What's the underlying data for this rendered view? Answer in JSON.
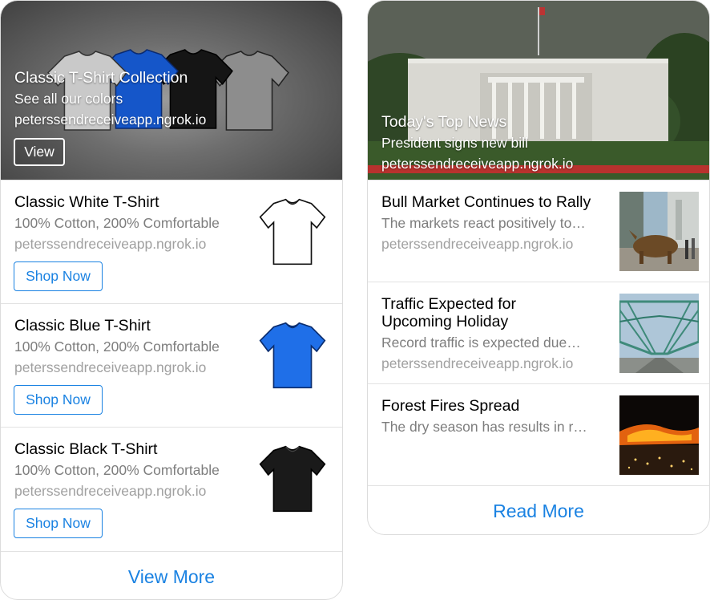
{
  "shop_card": {
    "hero": {
      "title": "Classic T-Shirt Collection",
      "subtitle": "See all our colors",
      "url": "peterssendreceiveapp.ngrok.io",
      "button": "View"
    },
    "items": [
      {
        "title": "Classic White T-Shirt",
        "subtitle": "100% Cotton, 200% Comfortable",
        "url": "peterssendreceiveapp.ngrok.io",
        "button": "Shop Now",
        "color": "#ffffff"
      },
      {
        "title": "Classic Blue T-Shirt",
        "subtitle": "100% Cotton, 200% Comfortable",
        "url": "peterssendreceiveapp.ngrok.io",
        "button": "Shop Now",
        "color": "#1f6fe8"
      },
      {
        "title": "Classic Black T-Shirt",
        "subtitle": "100% Cotton, 200% Comfortable",
        "url": "peterssendreceiveapp.ngrok.io",
        "button": "Shop Now",
        "color": "#1a1a1a"
      }
    ],
    "footer": "View More"
  },
  "news_card": {
    "hero": {
      "title": "Today's Top News",
      "subtitle": "President signs new bill",
      "url": "peterssendreceiveapp.ngrok.io"
    },
    "items": [
      {
        "title_lines": [
          "Bull Market Continues to Rally"
        ],
        "subtitle": "The markets react positively to…",
        "url": "peterssendreceiveapp.ngrok.io"
      },
      {
        "title_lines": [
          "Traffic Expected for",
          "Upcoming Holiday"
        ],
        "subtitle": "Record traffic is expected due…",
        "url": "peterssendreceiveapp.ngrok.io"
      },
      {
        "title_lines": [
          "Forest Fires Spread"
        ],
        "subtitle": "The dry season has results in r…",
        "url": ""
      }
    ],
    "footer": "Read More"
  },
  "colors": {
    "accent": "#1a82e2",
    "secondary_text": "#7d7d7d",
    "url_text": "#a0a0a0"
  }
}
